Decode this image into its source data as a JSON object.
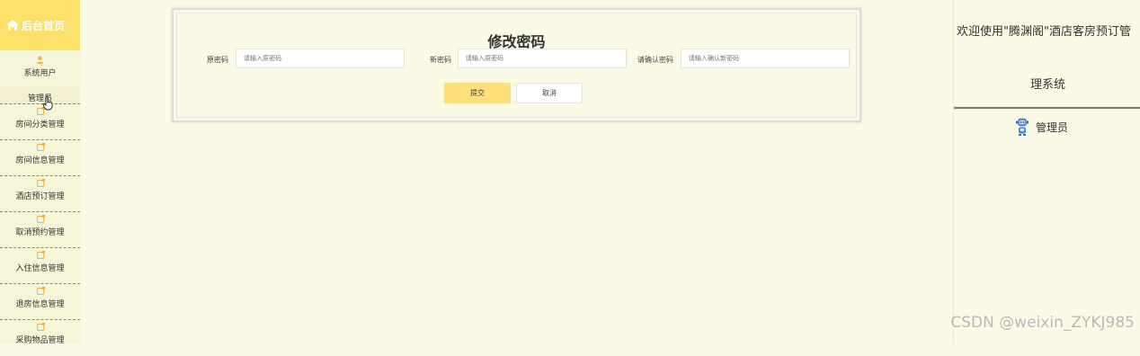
{
  "sidebar": {
    "home_label": "后台首页",
    "user_group_label": "系统用户",
    "admin_item_label": "管理员",
    "items": [
      {
        "label": "房间分类管理",
        "icon": "edit-icon"
      },
      {
        "label": "房间信息管理",
        "icon": "edit-icon"
      },
      {
        "label": "酒店预订管理",
        "icon": "edit-icon"
      },
      {
        "label": "取消预约管理",
        "icon": "edit-icon"
      },
      {
        "label": "入住信息管理",
        "icon": "edit-icon"
      },
      {
        "label": "退房信息管理",
        "icon": "edit-icon"
      },
      {
        "label": "采购物品管理",
        "icon": "edit-icon"
      }
    ]
  },
  "form": {
    "title": "修改密码",
    "old_password_label": "原密码",
    "old_password_placeholder": "请输入原密码",
    "new_password_label": "新密码",
    "new_password_placeholder": "请输入原密码",
    "confirm_password_label": "请确认密码",
    "confirm_password_placeholder": "请输入确认新密码",
    "submit_label": "提交",
    "cancel_label": "取消"
  },
  "right_panel": {
    "welcome_line1": "欢迎使用\"腾渊阁\"酒店客房预订管",
    "welcome_line2": "理系统",
    "user_role": "管理员"
  },
  "watermark": "CSDN @weixin_ZYKJ985",
  "colors": {
    "accent": "#fde07a",
    "home_bg": "#fbe06a",
    "page_bg": "#fafae6",
    "icon": "#f4b23a"
  }
}
